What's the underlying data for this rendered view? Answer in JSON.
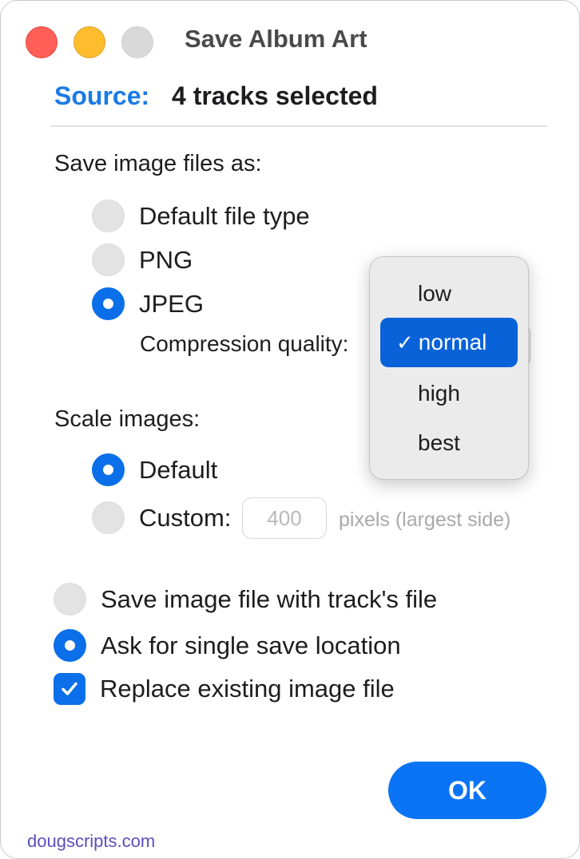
{
  "window": {
    "title": "Save Album Art"
  },
  "source": {
    "label": "Source:",
    "value": "4 tracks selected"
  },
  "file_type": {
    "heading": "Save image files as:",
    "options": [
      "Default file type",
      "PNG",
      "JPEG"
    ],
    "selected": "JPEG",
    "compression_label": "Compression quality:"
  },
  "quality_menu": {
    "items": [
      "low",
      "normal",
      "high",
      "best"
    ],
    "selected": "normal"
  },
  "scale": {
    "heading": "Scale images:",
    "default_label": "Default",
    "custom_label": "Custom:",
    "selected": "Default",
    "pixels_value": "400",
    "pixels_caption": "pixels (largest side)"
  },
  "save_location": {
    "options": [
      "Save image file with track's file",
      "Ask for single save location"
    ],
    "selected": "Ask for single save location"
  },
  "replace": {
    "label": "Replace existing image file",
    "checked": true
  },
  "ok_label": "OK",
  "footer": "dougscripts.com",
  "colors": {
    "accent": "#0a6fe8",
    "source_label": "#1a7ae6",
    "footer": "#5a4fbf"
  }
}
